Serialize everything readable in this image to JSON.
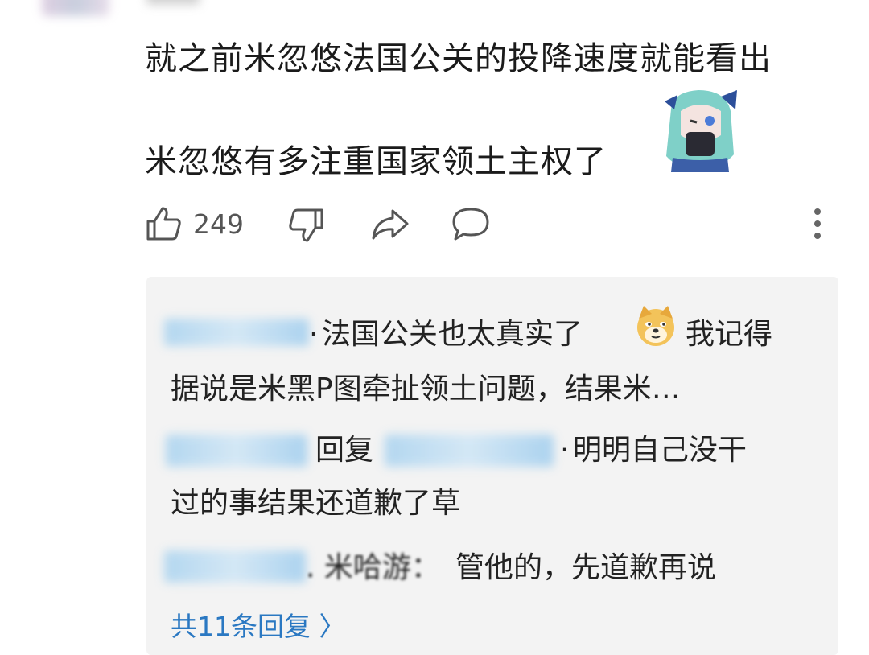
{
  "comment": {
    "line1": "就之前米忽悠法国公关的投降速度就能看出",
    "line2": "米忽悠有多注重国家领土主权了"
  },
  "actions": {
    "like_count": "249"
  },
  "replies": [
    {
      "separator": "·",
      "text_a": "法国公关也太真实了",
      "text_b": "我记得",
      "text_c": "据说是米黑P图牵扯领土问题，结果米…"
    },
    {
      "reply_word": "回复",
      "separator": "·",
      "text_a": "明明自己没干",
      "text_b": "过的事结果还道歉了草"
    },
    {
      "name_suffix": ". 米哈游：",
      "text_a": "管他的，先道歉再说"
    }
  ],
  "more_replies": "共11条回复 〉",
  "colors": {
    "accent_blue": "#2a78c2",
    "reply_bg": "#f3f3f3"
  }
}
